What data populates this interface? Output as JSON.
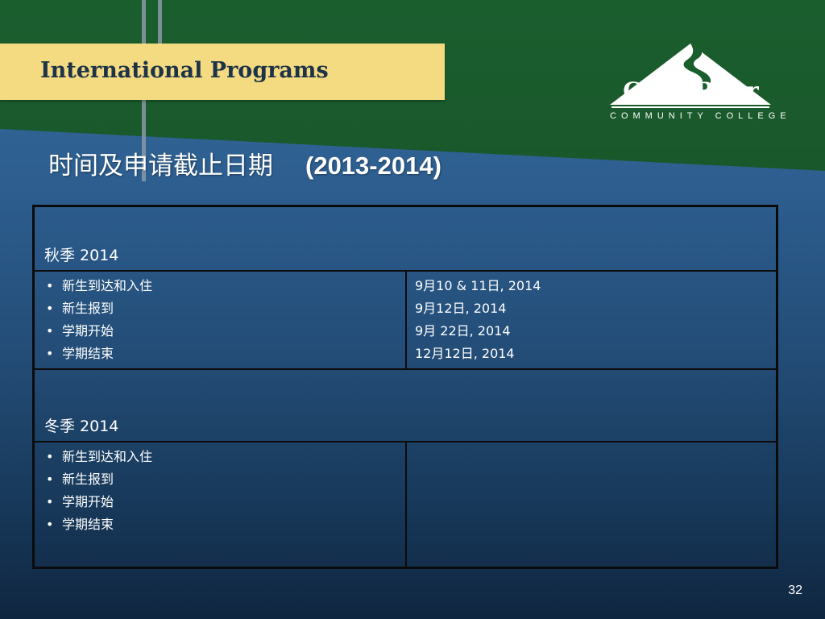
{
  "banner": {
    "title": "International Programs"
  },
  "logo": {
    "name": "GreenRiver",
    "subtitle": "COMMUNITY COLLEGE"
  },
  "heading": {
    "text": "时间及申请截止日期",
    "years": "(2013-2014)"
  },
  "schedule": {
    "terms": [
      {
        "season": "秋季 2014",
        "items": [
          "新生到达和入住",
          "新生报到",
          "学期开始",
          "学期结束"
        ],
        "dates": [
          "9月10 & 11日, 2014",
          "9月12日, 2014",
          "9月 22日, 2014",
          "12月12日, 2014"
        ]
      },
      {
        "season": "冬季 2014",
        "items": [
          "新生到达和入住",
          "新生报到",
          "学期开始",
          "学期结束"
        ],
        "dates": []
      }
    ]
  },
  "page_number": "32",
  "colors": {
    "green_band": "#1b5e2e",
    "title_bar": "#f4da80",
    "background_top": "#356a9c",
    "background_bottom": "#0f2640"
  },
  "icons": {
    "bullet": "•",
    "logo_mark": "mountain-icon"
  }
}
